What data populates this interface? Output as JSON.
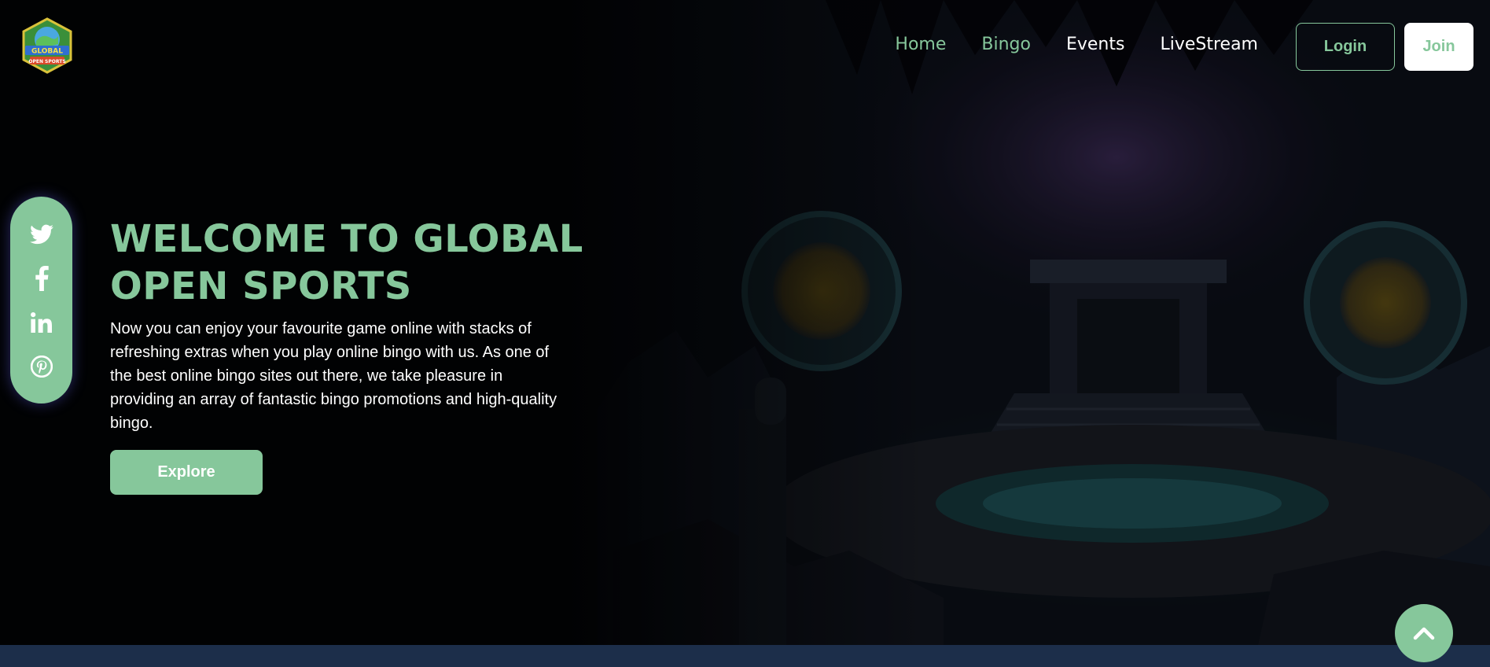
{
  "header": {
    "logo_alt": "Global Open Sports",
    "nav": [
      {
        "label": "Home"
      },
      {
        "label": "Bingo"
      },
      {
        "label": "Events"
      },
      {
        "label": "LiveStream"
      }
    ],
    "login_label": "Login",
    "join_label": "Join"
  },
  "hero": {
    "title": "WELCOME TO GLOBAL OPEN SPORTS",
    "description": "Now you can enjoy your favourite game online with stacks of refreshing extras when you play online bingo with us. As one of the best online bingo sites out there, we take pleasure in providing an array of fantastic bingo promotions and high-quality bingo.",
    "cta_label": "Explore"
  },
  "social": {
    "icons": [
      "twitter-icon",
      "facebook-icon",
      "linkedin-icon",
      "pinterest-icon"
    ]
  },
  "scroll_top": {
    "icon": "chevron-up-icon"
  },
  "colors": {
    "accent": "#86c79b",
    "background": "#020305",
    "footer_band": "#1c2e4a",
    "text": "#ffffff"
  }
}
